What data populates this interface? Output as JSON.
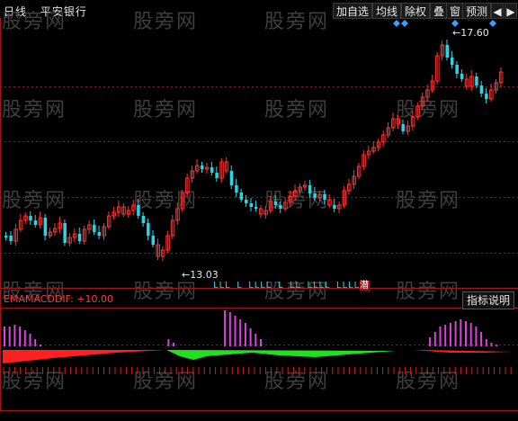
{
  "header": {
    "period": "日线",
    "stock_name": "平安银行"
  },
  "toolbar": {
    "add_watch": "加自选",
    "ma": "均线",
    "ex_rights": "除权",
    "overlay": "叠",
    "window": "窗",
    "forecast": "预测"
  },
  "watermark": "股旁网",
  "price_panel": {
    "high_label": "17.60",
    "low_label": "13.03",
    "signal_text": "LLL L LLLL L LL LLLL LLLL",
    "signal_tail": "潜",
    "candle_up_color": "#ff3232",
    "candle_down_color": "#22d8e8"
  },
  "indicator_panel": {
    "label": "EMAMACDDIF: +10.00",
    "explain_button": "指标说明",
    "bar_color": "#e040e0",
    "pos_color": "#ff2020",
    "neg_color": "#20e020"
  }
}
